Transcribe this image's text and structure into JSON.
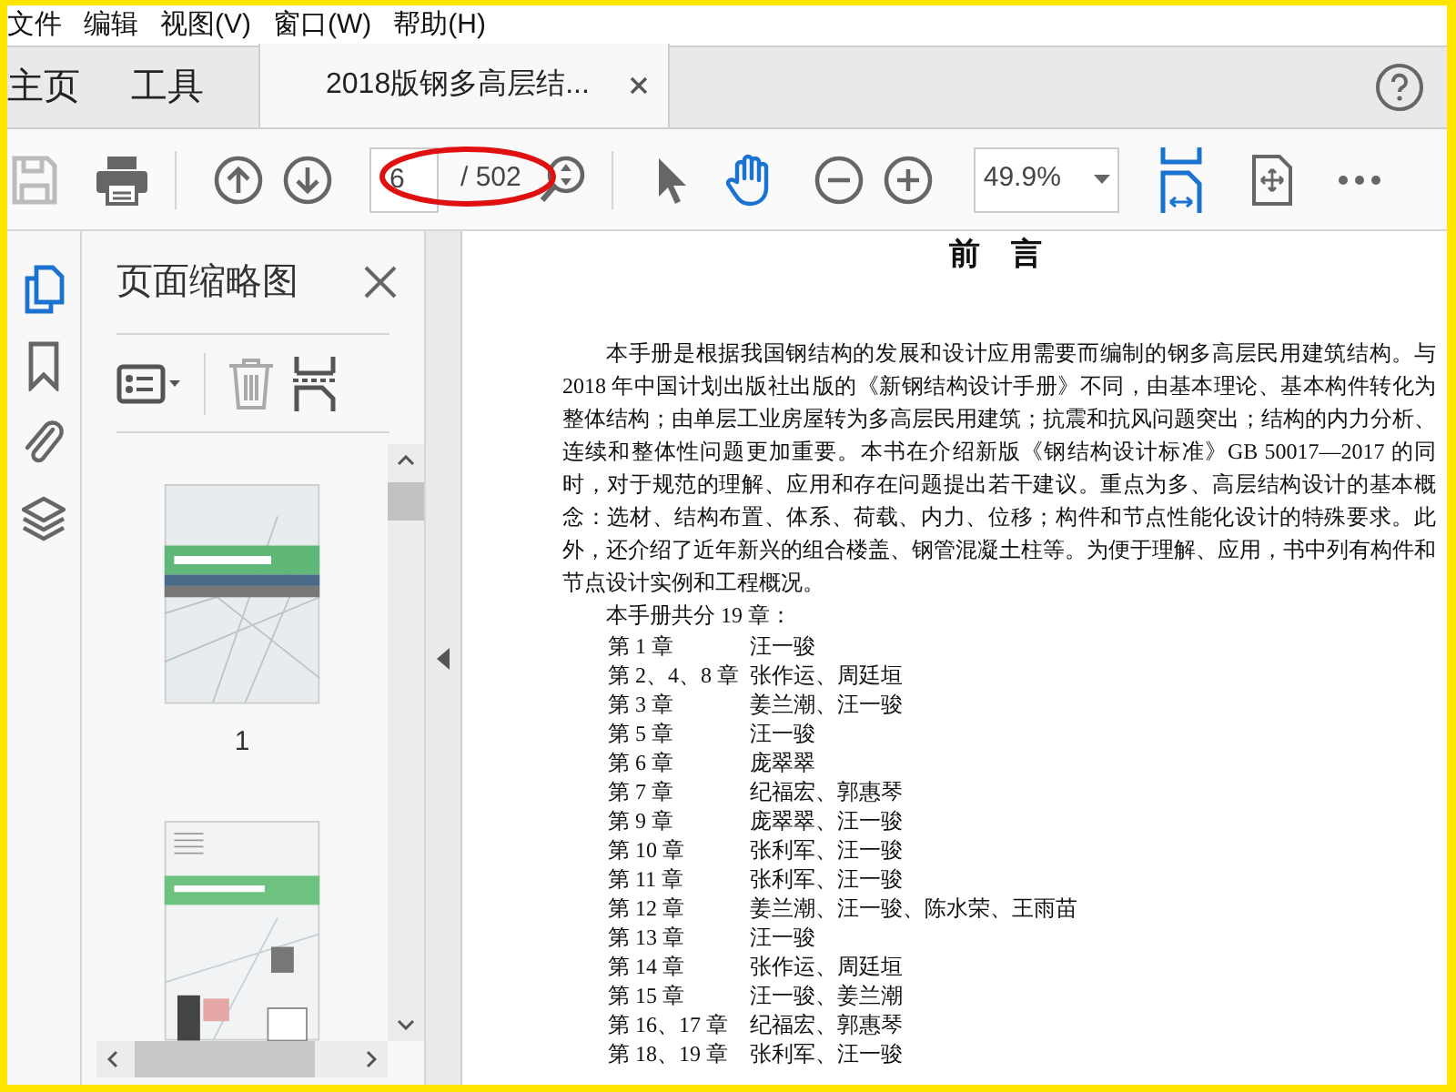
{
  "menu": [
    {
      "label": "文件"
    },
    {
      "label": "编辑"
    },
    {
      "label": "视图(V)"
    },
    {
      "label": "窗口(W)"
    },
    {
      "label": "帮助(H)"
    }
  ],
  "tabs": [
    {
      "kind": "nav",
      "label": "主页",
      "selected": false
    },
    {
      "kind": "nav",
      "label": "工具",
      "selected": false
    },
    {
      "kind": "document",
      "label": "2018版钢多高层结...",
      "selected": true
    }
  ],
  "toolbar": {
    "page_field": {
      "value": "6",
      "total": "/ 502"
    },
    "tools": [
      {
        "kind": "select",
        "selected": false
      },
      {
        "kind": "hand",
        "selected": true
      }
    ],
    "zoom_field": {
      "value": "49.9%"
    }
  },
  "side_icons": [
    {
      "kind": "pages",
      "selected": true
    },
    {
      "kind": "bookmarks",
      "selected": false
    },
    {
      "kind": "attachments",
      "selected": false
    },
    {
      "kind": "layers",
      "selected": false
    }
  ],
  "panel": {
    "title": "页面缩略图",
    "thumbnails": [
      {
        "kind": "cover",
        "label": "1"
      },
      {
        "kind": "back_cover"
      }
    ]
  },
  "document": {
    "title": "前　言",
    "paragraph": "本手册是根据我国钢结构的发展和设计应用需要而编制的钢多高层民用建筑结构。与 2018 年中国计划出版社出版的《新钢结构设计手册》不同，由基本理论、基本构件转化为整体结构；由单层工业房屋转为多高层民用建筑；抗震和抗风问题突出；结构的内力分析、连续和整体性问题更加重要。本书在介绍新版《钢结构设计标准》GB 50017—2017 的同时，对于规范的理解、应用和存在问题提出若干建议。重点为多、高层结构设计的基本概念：选材、结构布置、体系、荷载、内力、位移；构件和节点性能化设计的特殊要求。此外，还介绍了近年新兴的组合楼盖、钢管混凝土柱等。为便于理解、应用，书中列有构件和节点设计实例和工程概况。",
    "chapter_intro": "本手册共分 19 章：",
    "chapters": [
      {
        "chapter": "第 1 章",
        "authors": "汪一骏"
      },
      {
        "chapter": "第 2、4、8 章",
        "authors": "张作运、周廷垣"
      },
      {
        "chapter": "第 3 章",
        "authors": "姜兰潮、汪一骏"
      },
      {
        "chapter": "第 5 章",
        "authors": "汪一骏"
      },
      {
        "chapter": "第 6 章",
        "authors": "庞翠翠"
      },
      {
        "chapter": "第 7 章",
        "authors": "纪福宏、郭惠琴"
      },
      {
        "chapter": "第 9 章",
        "authors": "庞翠翠、汪一骏"
      },
      {
        "chapter": "第 10 章",
        "authors": "张利军、汪一骏"
      },
      {
        "chapter": "第 11 章",
        "authors": "张利军、汪一骏"
      },
      {
        "chapter": "第 12 章",
        "authors": "姜兰潮、汪一骏、陈水荣、王雨苗"
      },
      {
        "chapter": "第 13 章",
        "authors": "汪一骏"
      },
      {
        "chapter": "第 14 章",
        "authors": "张作运、周廷垣"
      },
      {
        "chapter": "第 15 章",
        "authors": "汪一骏、姜兰潮"
      },
      {
        "chapter": "第 16、17 章",
        "authors": "纪福宏、郭惠琴"
      },
      {
        "chapter": "第 18、19 章",
        "authors": "张利军、汪一骏"
      }
    ]
  }
}
